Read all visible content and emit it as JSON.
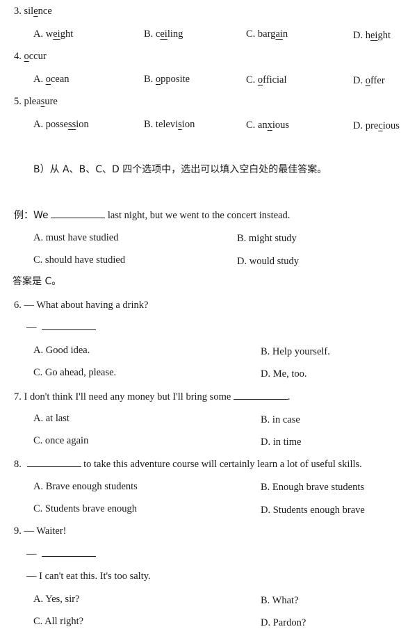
{
  "sections": {
    "q3": {
      "num": "3.",
      "word": {
        "pre": "sil",
        "ul": "e",
        "post": "nce"
      },
      "options": [
        {
          "letter": "A.",
          "pre": "w",
          "ul": "ei",
          "post": "ght"
        },
        {
          "letter": "B.",
          "pre": "c",
          "ul": "ei",
          "post": "ling"
        },
        {
          "letter": "C.",
          "pre": "barg",
          "ul": "ai",
          "post": "n"
        },
        {
          "letter": "D.",
          "pre": "h",
          "ul": "ei",
          "post": "ght"
        }
      ]
    },
    "q4": {
      "num": "4.",
      "word": {
        "pre": "",
        "ul": "o",
        "post": "ccur"
      },
      "options": [
        {
          "letter": "A.",
          "pre": "",
          "ul": "o",
          "post": "cean"
        },
        {
          "letter": "B.",
          "pre": "",
          "ul": "o",
          "post": "pposite"
        },
        {
          "letter": "C.",
          "pre": "",
          "ul": "o",
          "post": "fficial"
        },
        {
          "letter": "D.",
          "pre": "",
          "ul": "o",
          "post": "ffer"
        }
      ]
    },
    "q5": {
      "num": "5.",
      "word": {
        "pre": "plea",
        "ul": "s",
        "post": "ure"
      },
      "options": [
        {
          "letter": "A.",
          "pre": "posse",
          "ul": "ss",
          "post": "ion"
        },
        {
          "letter": "B.",
          "pre": "televi",
          "ul": "s",
          "post": "ion"
        },
        {
          "letter": "C.",
          "pre": "an",
          "ul": "x",
          "post": "ious"
        },
        {
          "letter": "D.",
          "pre": "pre",
          "ul": "c",
          "post": "ious"
        }
      ]
    },
    "section_b_heading": "B）从 A、B、C、D 四个选项中，选出可以填入空白处的最佳答案。",
    "example": {
      "prefix": "例：We",
      "suffix": "last night, but we went to the concert instead.",
      "options": [
        {
          "letter": "A.",
          "text": "must have studied"
        },
        {
          "letter": "B.",
          "text": "might study"
        },
        {
          "letter": "C.",
          "text": "should have studied"
        },
        {
          "letter": "D.",
          "text": "would study"
        }
      ],
      "answer": "答案是 C。"
    },
    "q6": {
      "num": "6.",
      "line1": "— What about having a drink?",
      "dash": "—",
      "options": [
        {
          "letter": "A.",
          "text": "Good idea."
        },
        {
          "letter": "B.",
          "text": "Help yourself."
        },
        {
          "letter": "C.",
          "text": "Go ahead, please."
        },
        {
          "letter": "D.",
          "text": "Me, too."
        }
      ]
    },
    "q7": {
      "num": "7.",
      "prefix": "I don't think I'll need any money but I'll bring some",
      "suffix": ".",
      "options": [
        {
          "letter": "A.",
          "text": "at last"
        },
        {
          "letter": "B.",
          "text": "in case"
        },
        {
          "letter": "C.",
          "text": "once again"
        },
        {
          "letter": "D.",
          "text": "in time"
        }
      ]
    },
    "q8": {
      "num": "8.",
      "suffix": "to take this adventure course will certainly learn a lot of useful skills.",
      "options": [
        {
          "letter": "A.",
          "text": "Brave enough students"
        },
        {
          "letter": "B.",
          "text": "Enough brave students"
        },
        {
          "letter": "C.",
          "text": "Students brave enough"
        },
        {
          "letter": "D.",
          "text": "Students enough brave"
        }
      ]
    },
    "q9": {
      "num": "9.",
      "line1": "— Waiter!",
      "dash": "—",
      "line3": "— I can't eat this. It's too salty.",
      "options": [
        {
          "letter": "A.",
          "text": "Yes, sir?"
        },
        {
          "letter": "B.",
          "text": "What?"
        },
        {
          "letter": "C.",
          "text": "All right?"
        },
        {
          "letter": "D.",
          "text": "Pardon?"
        }
      ]
    }
  }
}
